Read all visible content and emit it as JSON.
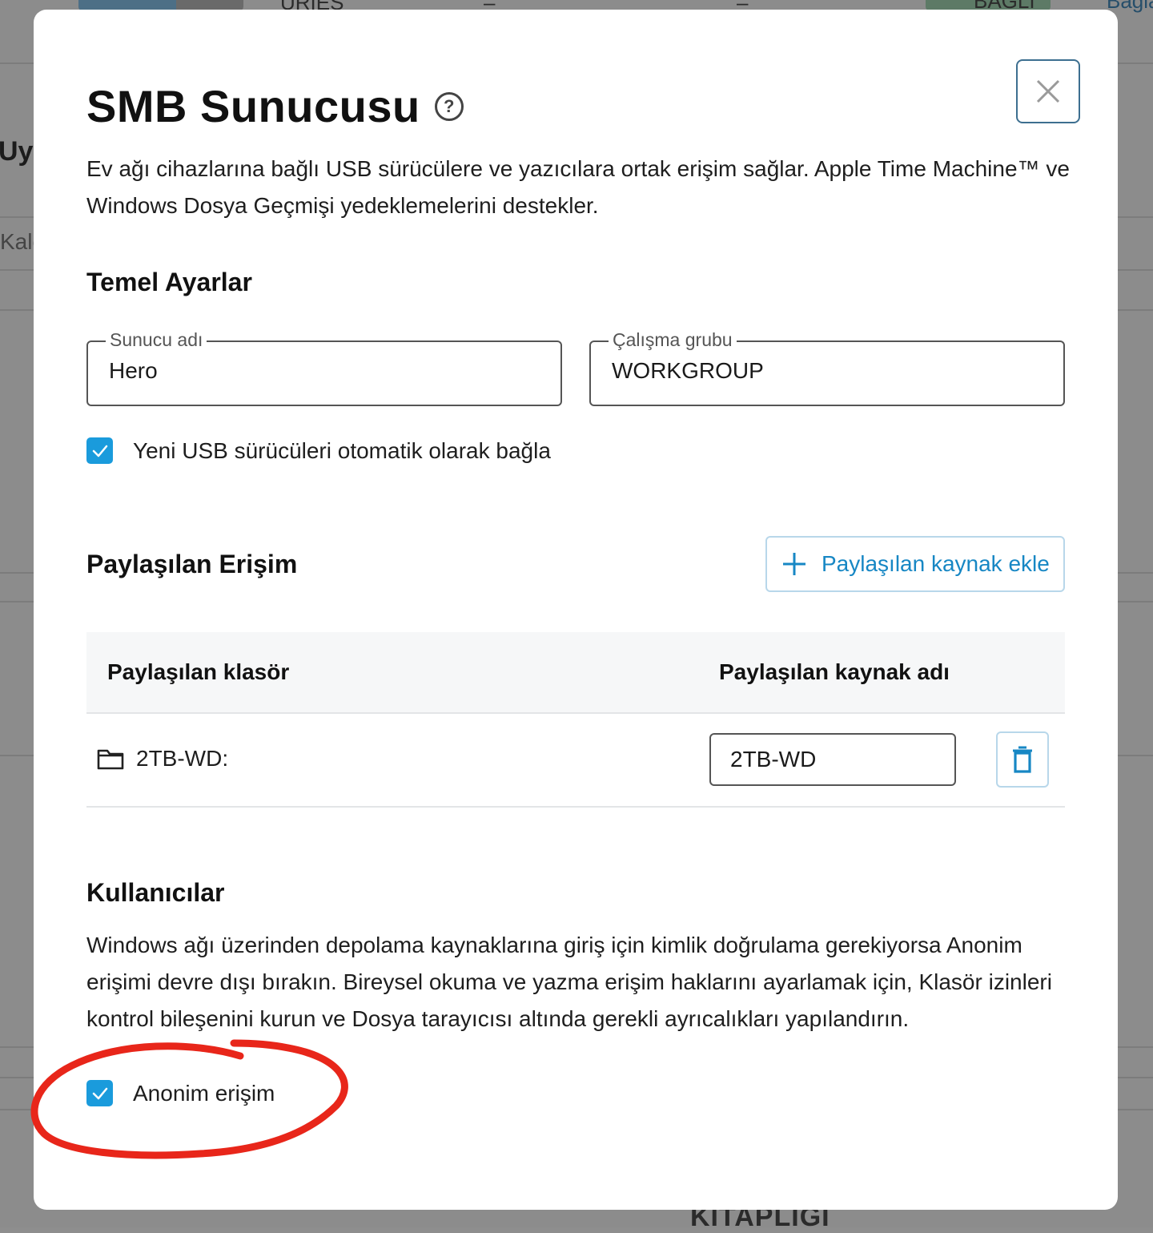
{
  "background": {
    "top_fragments": [
      "URIES",
      "–",
      "–",
      "BAĞLI",
      "Bağla"
    ],
    "left_fragments": [
      "Uyg",
      "Kalc"
    ],
    "bottom_fragment": "KITAPLIĞI"
  },
  "dialog": {
    "title": "SMB Sunucusu",
    "help_icon": "question-circle-icon",
    "close_icon": "close-icon",
    "description": "Ev ağı cihazlarına bağlı USB sürücülere ve yazıcılara ortak erişim sağlar. Apple Time Machine™ ve Windows Dosya Geçmişi yedeklemelerini destekler."
  },
  "basic_settings": {
    "title": "Temel Ayarlar",
    "server_name_label": "Sunucu adı",
    "server_name_value": "Hero",
    "workgroup_label": "Çalışma grubu",
    "workgroup_value": "WORKGROUP",
    "auto_mount_label": "Yeni USB sürücüleri otomatik olarak bağla",
    "auto_mount_checked": true
  },
  "shared_access": {
    "title": "Paylaşılan Erişim",
    "add_button_label": "Paylaşılan kaynak ekle",
    "columns": [
      "Paylaşılan klasör",
      "Paylaşılan kaynak adı"
    ],
    "rows": [
      {
        "folder": "2TB-WD:",
        "share_name": "2TB-WD"
      }
    ]
  },
  "users": {
    "title": "Kullanıcılar",
    "description": "Windows ağı üzerinden depolama kaynaklarına giriş için kimlik doğrulama gerekiyorsa Anonim erişimi devre dışı bırakın. Bireysel okuma ve yazma erişim haklarını ayarlamak için, Klasör izinleri kontrol bileşenini kurun ve Dosya tarayıcısı altında gerekli ayrıcalıkları yapılandırın.",
    "anonymous_label": "Anonim erişim",
    "anonymous_checked": true
  },
  "colors": {
    "accent": "#1a9bdc",
    "link": "#1787c4",
    "annotation": "#e8261a",
    "overlay": "#8c8c8c"
  }
}
